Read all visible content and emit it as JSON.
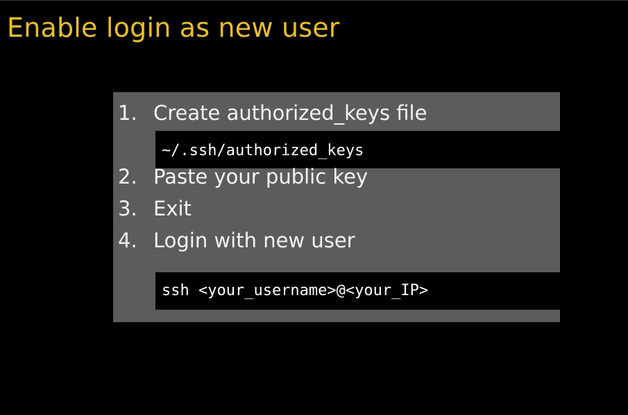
{
  "title": "Enable login as new user",
  "steps": [
    {
      "num": "1.",
      "text": "Create authorized_keys file"
    },
    {
      "num": "2.",
      "text": "Paste your public key"
    },
    {
      "num": "3.",
      "text": "Exit"
    },
    {
      "num": "4.",
      "text": "Login with new user"
    }
  ],
  "code_blocks": [
    "~/.ssh/authorized_keys",
    "ssh <your_username>@<your_IP>"
  ],
  "colors": {
    "title": "#e8bf2a",
    "panel": "#5c5c5c",
    "code_background": "#000000",
    "text": "#f2f2f2"
  }
}
